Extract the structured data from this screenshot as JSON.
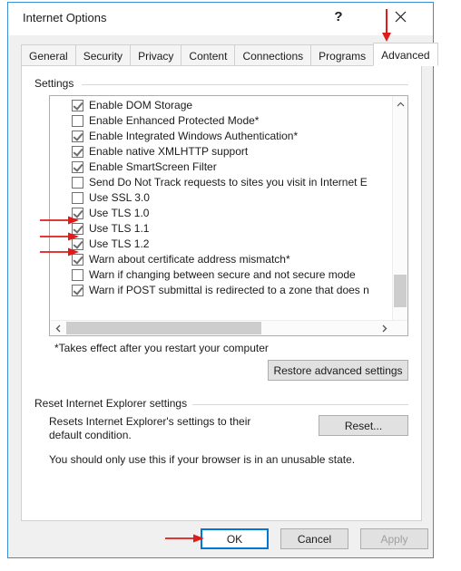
{
  "window": {
    "title": "Internet Options",
    "help_label": "?",
    "close_icon": "close-icon"
  },
  "tabs": [
    {
      "label": "General",
      "active": false
    },
    {
      "label": "Security",
      "active": false
    },
    {
      "label": "Privacy",
      "active": false
    },
    {
      "label": "Content",
      "active": false
    },
    {
      "label": "Connections",
      "active": false
    },
    {
      "label": "Programs",
      "active": false
    },
    {
      "label": "Advanced",
      "active": true
    }
  ],
  "settings_group": {
    "label": "Settings",
    "items": [
      {
        "label": "Enable DOM Storage",
        "checked": true,
        "annotated": false
      },
      {
        "label": "Enable Enhanced Protected Mode*",
        "checked": false,
        "annotated": false
      },
      {
        "label": "Enable Integrated Windows Authentication*",
        "checked": true,
        "annotated": false
      },
      {
        "label": "Enable native XMLHTTP support",
        "checked": true,
        "annotated": false
      },
      {
        "label": "Enable SmartScreen Filter",
        "checked": true,
        "annotated": false
      },
      {
        "label": "Send Do Not Track requests to sites you visit in Internet E",
        "checked": false,
        "annotated": false
      },
      {
        "label": "Use SSL 3.0",
        "checked": false,
        "annotated": false
      },
      {
        "label": "Use TLS 1.0",
        "checked": true,
        "annotated": true
      },
      {
        "label": "Use TLS 1.1",
        "checked": true,
        "annotated": true
      },
      {
        "label": "Use TLS 1.2",
        "checked": true,
        "annotated": true
      },
      {
        "label": "Warn about certificate address mismatch*",
        "checked": true,
        "annotated": false
      },
      {
        "label": "Warn if changing between secure and not secure mode",
        "checked": false,
        "annotated": false
      },
      {
        "label": "Warn if POST submittal is redirected to a zone that does n",
        "checked": true,
        "annotated": false
      }
    ],
    "scroll_up_icon": "chevron-up-icon",
    "scroll_down_icon": "chevron-down-icon",
    "scroll_left_icon": "chevron-left-icon",
    "scroll_right_icon": "chevron-right-icon"
  },
  "restart_note": "*Takes effect after you restart your computer",
  "restore_advanced_label": "Restore advanced settings",
  "reset_group": {
    "label": "Reset Internet Explorer settings",
    "description": "Resets Internet Explorer's settings to their default condition.",
    "button_label": "Reset...",
    "warning": "You should only use this if your browser is in an unusable state."
  },
  "actions": {
    "ok_label": "OK",
    "cancel_label": "Cancel",
    "apply_label": "Apply"
  },
  "annotation": {
    "color": "#e01b1b",
    "count": 5
  }
}
